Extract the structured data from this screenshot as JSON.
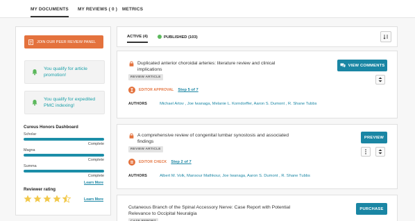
{
  "topnav": {
    "tabs": [
      "MY DOCUMENTS",
      "MY REVIEWS ( 0 )",
      "METRICS"
    ]
  },
  "sidebar": {
    "peer_button": "JOIN OUR PEER REVIEW PANEL",
    "qualify_1": "You qualify for article promotion!",
    "qualify_2": "You qualify for expedited PMC indexing!",
    "honors_title": "Cureus Honors Dashboard",
    "levels": [
      {
        "name": "Scholar",
        "status": "Complete",
        "progress": 1.0
      },
      {
        "name": "Magna",
        "status": "Complete",
        "progress": 1.0
      },
      {
        "name": "Summa",
        "status": "Complete",
        "progress": 1.0
      }
    ],
    "learn_more": "Learn More",
    "reviewer_rating_title": "Reviewer rating",
    "rating_stars": 4.5,
    "learn_more_2": "Learn More"
  },
  "filter": {
    "active": "ACTIVE (4)",
    "published": "PUBLISHED (103)"
  },
  "cards": [
    {
      "title": "Duplicated anterior choroidal arteries: literature review and clinical implications",
      "type": "REVIEW ARTICLE",
      "status": "EDITOR APPROVAL",
      "step_label": "Step 5 of 7",
      "authors_label": "AUTHORS",
      "authors": "Michael Artov , Joe Iwanaga, Melanie L. Korndorffer, Aaron S. Dumont , R. Shane Tubbs",
      "button": "VIEW COMMENTS"
    },
    {
      "title": "A comprehensive review of congenital lumbar synostosis and associated findings",
      "type": "REVIEW ARTICLE",
      "status": "EDITOR CHECK",
      "step_label": "Step 2 of 7",
      "authors_label": "AUTHORS",
      "authors": "Albert M. Volk, Mansour Mathkour, Joe Iwanaga, Aaron S. Dumont , R. Shane Tubbs",
      "button": "PREVIEW"
    },
    {
      "title": "Cutaneous Branch of the Spinal Accessory Nerve: Case Report with Potential Relevance to Occipital Neuralgia",
      "type": "CASE REPORT",
      "button": "PURCHASE"
    }
  ],
  "colors": {
    "teal": "#1a86a4",
    "orange": "#e4723d",
    "green": "#5cb85c",
    "star": "#f2c94c"
  }
}
